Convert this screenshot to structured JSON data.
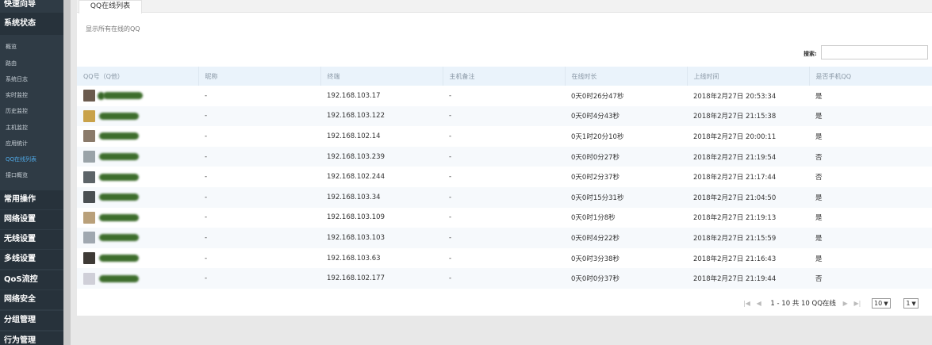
{
  "sidebar": {
    "top_item": "快速向导",
    "section_status": "系统状态",
    "status_items": [
      {
        "label": "概览"
      },
      {
        "label": "路由"
      },
      {
        "label": "系统日志"
      },
      {
        "label": "实时监控"
      },
      {
        "label": "历史监控"
      },
      {
        "label": "主机监控"
      },
      {
        "label": "应用统计"
      },
      {
        "label": "QQ在线列表",
        "active": true
      },
      {
        "label": "接口概览"
      }
    ],
    "sections": [
      {
        "label": "常用操作"
      },
      {
        "label": "网络设置"
      },
      {
        "label": "无线设置"
      },
      {
        "label": "多线设置"
      },
      {
        "label": "QoS流控"
      },
      {
        "label": "网络安全"
      },
      {
        "label": "分组管理"
      },
      {
        "label": "行为管理"
      }
    ]
  },
  "tab": {
    "label": "QQ在线列表"
  },
  "description": "显示所有在线的QQ",
  "search": {
    "label": "搜索:",
    "value": ""
  },
  "table": {
    "columns": [
      "QQ号（Q他）",
      "昵称",
      "终端",
      "主机备注",
      "在线时长",
      "上线时间",
      "是否手机QQ"
    ],
    "rows": [
      {
        "qq": "2",
        "nick": "-",
        "terminal": "192.168.103.17",
        "note": "-",
        "duration": "0天0时26分47秒",
        "online_time": "2018年2月27日 20:53:34",
        "mobile": "是"
      },
      {
        "qq": "",
        "nick": "-",
        "terminal": "192.168.103.122",
        "note": "-",
        "duration": "0天0时4分43秒",
        "online_time": "2018年2月27日 21:15:38",
        "mobile": "是"
      },
      {
        "qq": "",
        "nick": "-",
        "terminal": "192.168.102.14",
        "note": "-",
        "duration": "0天1时20分10秒",
        "online_time": "2018年2月27日 20:00:11",
        "mobile": "是"
      },
      {
        "qq": "",
        "nick": "-",
        "terminal": "192.168.103.239",
        "note": "-",
        "duration": "0天0时0分27秒",
        "online_time": "2018年2月27日 21:19:54",
        "mobile": "否"
      },
      {
        "qq": "",
        "nick": "-",
        "terminal": "192.168.102.244",
        "note": "-",
        "duration": "0天0时2分37秒",
        "online_time": "2018年2月27日 21:17:44",
        "mobile": "否"
      },
      {
        "qq": "",
        "nick": "-",
        "terminal": "192.168.103.34",
        "note": "-",
        "duration": "0天0时15分31秒",
        "online_time": "2018年2月27日 21:04:50",
        "mobile": "是"
      },
      {
        "qq": "",
        "nick": "-",
        "terminal": "192.168.103.109",
        "note": "-",
        "duration": "0天0时1分8秒",
        "online_time": "2018年2月27日 21:19:13",
        "mobile": "是"
      },
      {
        "qq": "",
        "nick": "-",
        "terminal": "192.168.103.103",
        "note": "-",
        "duration": "0天0时4分22秒",
        "online_time": "2018年2月27日 21:15:59",
        "mobile": "是"
      },
      {
        "qq": "",
        "nick": "-",
        "terminal": "192.168.103.63",
        "note": "-",
        "duration": "0天0时3分38秒",
        "online_time": "2018年2月27日 21:16:43",
        "mobile": "是"
      },
      {
        "qq": "",
        "nick": "-",
        "terminal": "192.168.102.177",
        "note": "-",
        "duration": "0天0时0分37秒",
        "online_time": "2018年2月27日 21:19:44",
        "mobile": "否"
      }
    ]
  },
  "pager": {
    "first_icon": "first-page-icon",
    "prev_icon": "prev-page-icon",
    "next_icon": "next-page-icon",
    "last_icon": "last-page-icon",
    "summary": "1 - 10 共 10 QQ在线",
    "page_size": "10",
    "page": "1"
  },
  "colors": {
    "sidebar_bg": "#2f3b45",
    "sidebar_active": "#4fa9e6",
    "header_bg": "#eaf3fb"
  }
}
